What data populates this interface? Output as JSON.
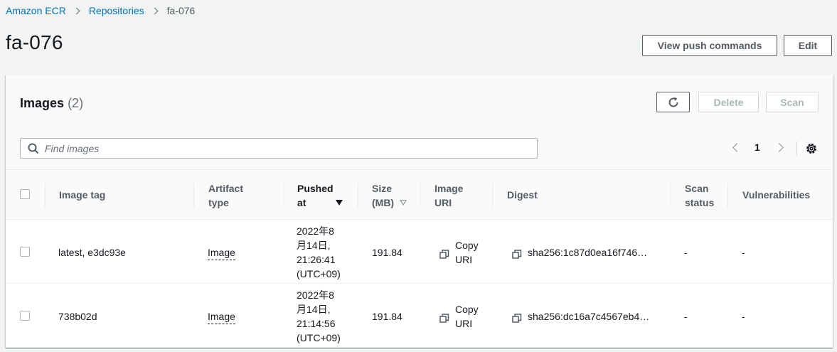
{
  "breadcrumb": {
    "items": [
      "Amazon ECR",
      "Repositories"
    ],
    "current": "fa-076"
  },
  "page": {
    "title": "fa-076",
    "view_push_label": "View push commands",
    "edit_label": "Edit"
  },
  "images_panel": {
    "title": "Images",
    "count": "(2)",
    "delete_label": "Delete",
    "scan_label": "Scan",
    "search_placeholder": "Find images",
    "page_number": "1"
  },
  "table": {
    "columns": {
      "image_tag": "Image tag",
      "artifact_type": [
        "Artifact",
        "type"
      ],
      "pushed_at": [
        "Pushed",
        "at"
      ],
      "size": [
        "Size",
        "(MB)"
      ],
      "image_uri": [
        "Image",
        "URI"
      ],
      "digest": "Digest",
      "scan_status": [
        "Scan",
        "status"
      ],
      "vulnerabilities": "Vulnerabilities"
    },
    "rows": [
      {
        "image_tag": "latest, e3dc93e",
        "artifact_type": "Image",
        "pushed_at": [
          "2022年8",
          "月14日,",
          "21:26:41",
          "(UTC+09)"
        ],
        "size": "191.84",
        "copy_uri": [
          "Copy",
          "URI"
        ],
        "digest": "sha256:1c87d0ea16f746…",
        "scan_status": "-",
        "vulnerabilities": "-"
      },
      {
        "image_tag": "738b02d",
        "artifact_type": "Image",
        "pushed_at": [
          "2022年8",
          "月14日,",
          "21:14:56",
          "(UTC+09)"
        ],
        "size": "191.84",
        "copy_uri": [
          "Copy",
          "URI"
        ],
        "digest": "sha256:dc16a7c4567eb4…",
        "scan_status": "-",
        "vulnerabilities": "-"
      }
    ]
  },
  "colors": {
    "link": "#0073bb",
    "background": "#f2f3f3",
    "text": "#16191f"
  },
  "icons": [
    "chevron-right-icon",
    "refresh-icon",
    "search-icon",
    "chevron-left-icon",
    "settings-gear-icon",
    "sort-descending-icon",
    "sort-icon",
    "copy-icon"
  ]
}
